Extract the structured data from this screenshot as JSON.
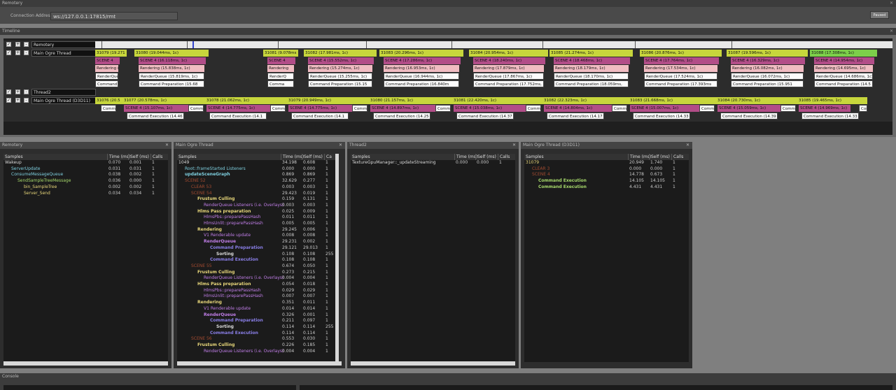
{
  "remotery": {
    "title": "Remotery",
    "connection_label": "Connection Address",
    "address": "ws://127.0.0.1:17815/rmt",
    "pause_button": "Paused"
  },
  "timeline": {
    "title": "Timeline",
    "threads": [
      "Remotery",
      "Main Ogre Thread",
      "Thread2",
      "Main Ogre Thread (D3D11)"
    ]
  },
  "colors": {
    "frame": "#c7d63c",
    "scene": "#b24d88",
    "rendering": "#f0bcc2",
    "command": "#fbfbfb",
    "last_frame": "#7ccf4a"
  },
  "mot_frames": [
    "31079 (19.271",
    "31080 (19.044ms, 1c)",
    "31081 (9.078ms",
    "31082 (17.981ms, 1c)",
    "31083 (20.296ms, 1c)",
    "31084 (20.954ms, 1c)",
    "31085 (21.274ms, 1c)",
    "31086 (20.876ms, 1c)",
    "31087 (19.596ms, 1c)",
    "31088 (17.308ms, 1c)"
  ],
  "mot_scenes": [
    "SCENE 4",
    "SCENE 4 (16.118ms, 1c)",
    "SCENE 4",
    "SCENE 4 (15.552ms, 1c)",
    "SCENE 4 (17.286ms, 1c)",
    "SCENE 4 (18.240ms, 1c)",
    "SCENE 4 (18.468ms, 1c)",
    "SCENE 4 (17.764ms, 1c)",
    "SCENE 4 (16.329ms, 1c)",
    "SCENE 4 (14.954ms, 1c)"
  ],
  "mot_render": [
    "Rendering (",
    "Rendering (15.838ms, 1c)",
    "Rendering",
    "Rendering (15.274ms, 1c)",
    "Rendering (16.953ms, 1c)",
    "Rendering (17.879ms, 1c)",
    "Rendering (18.179ms, 1c)",
    "Rendering (17.534ms, 1c)",
    "Rendering (16.082ms, 1c)",
    "Rendering (14.695ms, 1c)"
  ],
  "mot_rq": [
    "RenderQueue",
    "RenderQueue (15.819ms, 1c)",
    "RenderQ",
    "RenderQueue (15.255ms, 1c)",
    "RenderQueue (16.944ms, 1c)",
    "RenderQueue (17.867ms, 1c)",
    "RenderQueue (18.170ms, 1c)",
    "RenderQueue (17.524ms, 1c)",
    "RenderQueue (16.072ms, 1c)",
    "RenderQueue (14.686ms, 1c)"
  ],
  "mot_cmd": [
    "Command P",
    "Command Preparation (15.68",
    "Comma",
    "Command Preparation (15.15",
    "Command Preparation (16.840m",
    "Command Preparation (17.752ms,",
    "Command Preparation (18.059ms,",
    "Command Preparation (17.393ms",
    "Command Preparation (15.951",
    "Command Preparation (14.5"
  ],
  "d3d_frames": [
    "31076 (20.5",
    "31077 (20.578ms, 1c)",
    "31078 (21.062ms, 1c)",
    "31079 (20.949ms, 1c)",
    "31080 (21.157ms, 1c)",
    "31081 (22.420ms, 1c)",
    "31082 (22.323ms, 1c)",
    "31083 (21.668ms, 1c)",
    "31084 (20.730ms, 1c)",
    "31085 (19.465ms, 1c)"
  ],
  "d3d_scenes": [
    "SCENE 4 (15.107ms, 1c)",
    "SCENE 4 (14.775ms, 1c)",
    "SCENE 4 (14.775ms, 1c)",
    "SCENE 4 (14.897ms, 1c)",
    "SCENE 4 (15.038ms, 1c)",
    "SCENE 4 (14.804ms, 1c)",
    "SCENE 4 (15.007ms, 1c)",
    "SCENE 4 (15.059ms, 1c)",
    "SCENE 4 (14.969ms, 1c)"
  ],
  "d3d_cmd": [
    "Command Execution (14.46",
    "Command Execution (14.1",
    "Command Execution (14.1",
    "Command Execution (14.25",
    "Command Execution (14.37",
    "Command Execution (14.17",
    "Command Execution (14.33",
    "Command Execution (14.39",
    "Command Execution (14.33"
  ],
  "d3d_comm": [
    "Comm",
    "Comm",
    "Comm",
    "Comm",
    "Comm",
    "Comm",
    "Comm",
    "Comm",
    "Comm",
    "Con"
  ],
  "headers": {
    "samples": "Samples",
    "time": "Time (ms)",
    "self": "Self (ms)",
    "calls": "Calls",
    "calls_short": "Ca"
  },
  "panels": [
    {
      "title": "Remotery",
      "rows": [
        [
          "Wakeup",
          "0.070",
          "0.001",
          "1"
        ],
        [
          "ServerUpdate",
          "0.031",
          "0.031",
          "1"
        ],
        [
          "ConsumeMessageQueue",
          "0.038",
          "0.002",
          "1"
        ],
        [
          "SendSampleTreeMessage",
          "0.036",
          "0.000",
          "1"
        ],
        [
          "bin_SampleTree",
          "0.002",
          "0.002",
          "1"
        ],
        [
          "Server_Send",
          "0.034",
          "0.034",
          "1"
        ]
      ]
    },
    {
      "title": "Main Ogre Thread",
      "rows": [
        [
          "1049",
          "34.198",
          "0.608",
          "1"
        ],
        [
          "Root::frameStarted Listeners",
          "0.000",
          "0.000",
          "1"
        ],
        [
          "updateSceneGraph",
          "0.869",
          "0.869",
          "1"
        ],
        [
          "SCENE 52",
          "32.629",
          "0.277",
          "1"
        ],
        [
          "CLEAR 53",
          "0.003",
          "0.003",
          "1"
        ],
        [
          "SCENE 54",
          "29.423",
          "0.019",
          "1"
        ],
        [
          "Frustum Culling",
          "0.159",
          "0.131",
          "1"
        ],
        [
          "RenderQueue Listeners (i.e. Overlays)",
          "0.003",
          "0.003",
          "1"
        ],
        [
          "Hlms Pass preparation",
          "0.025",
          "0.009",
          "1"
        ],
        [
          "HlmsPbs::preparePassHash",
          "0.011",
          "0.011",
          "1"
        ],
        [
          "HlmsUnlit::preparePassHash",
          "0.005",
          "0.005",
          "1"
        ],
        [
          "Rendering",
          "29.245",
          "0.006",
          "1"
        ],
        [
          "V1 Renderable update",
          "0.008",
          "0.008",
          "1"
        ],
        [
          "RenderQueue",
          "29.231",
          "0.002",
          "1"
        ],
        [
          "Command Preparation",
          "29.121",
          "29.013",
          "1"
        ],
        [
          "Sorting",
          "0.108",
          "0.108",
          "255"
        ],
        [
          "Command Execution",
          "0.108",
          "0.108",
          "1"
        ],
        [
          "SCENE 55",
          "0.674",
          "0.050",
          "1"
        ],
        [
          "Frustum Culling",
          "0.273",
          "0.215",
          "1"
        ],
        [
          "RenderQueue Listeners (i.e. Overlays)",
          "0.004",
          "0.004",
          "1"
        ],
        [
          "Hlms Pass preparation",
          "0.054",
          "0.018",
          "1"
        ],
        [
          "HlmsPbs::preparePassHash",
          "0.029",
          "0.029",
          "1"
        ],
        [
          "HlmsUnlit::preparePassHash",
          "0.007",
          "0.007",
          "1"
        ],
        [
          "Rendering",
          "0.351",
          "0.011",
          "1"
        ],
        [
          "V1 Renderable update",
          "0.014",
          "0.014",
          "1"
        ],
        [
          "RenderQueue",
          "0.326",
          "0.001",
          "1"
        ],
        [
          "Command Preparation",
          "0.211",
          "0.097",
          "1"
        ],
        [
          "Sorting",
          "0.114",
          "0.114",
          "255"
        ],
        [
          "Command Execution",
          "0.114",
          "0.114",
          "1"
        ],
        [
          "SCENE 56",
          "0.553",
          "0.030",
          "1"
        ],
        [
          "Frustum Culling",
          "0.226",
          "0.185",
          "1"
        ],
        [
          "RenderQueue Listeners (i.e. Overlays)",
          "0.004",
          "0.004",
          "1"
        ]
      ]
    },
    {
      "title": "Thread2",
      "rows": [
        [
          "TextureGpuManager::_updateStreaming",
          "0.000",
          "0.000",
          "1"
        ]
      ]
    },
    {
      "title": "Main Ogre Thread (D3D11)",
      "rows": [
        [
          "31079",
          "20.949",
          "1.740",
          "1"
        ],
        [
          "CLEAR 3",
          "0.000",
          "0.000",
          "1"
        ],
        [
          "SCENE 4",
          "14.778",
          "0.673",
          "1"
        ],
        [
          "Command Execution",
          "14.105",
          "14.105",
          "1"
        ],
        [
          "Command Execution",
          "4.431",
          "4.431",
          "1"
        ]
      ]
    }
  ],
  "console": {
    "title": "Console"
  }
}
